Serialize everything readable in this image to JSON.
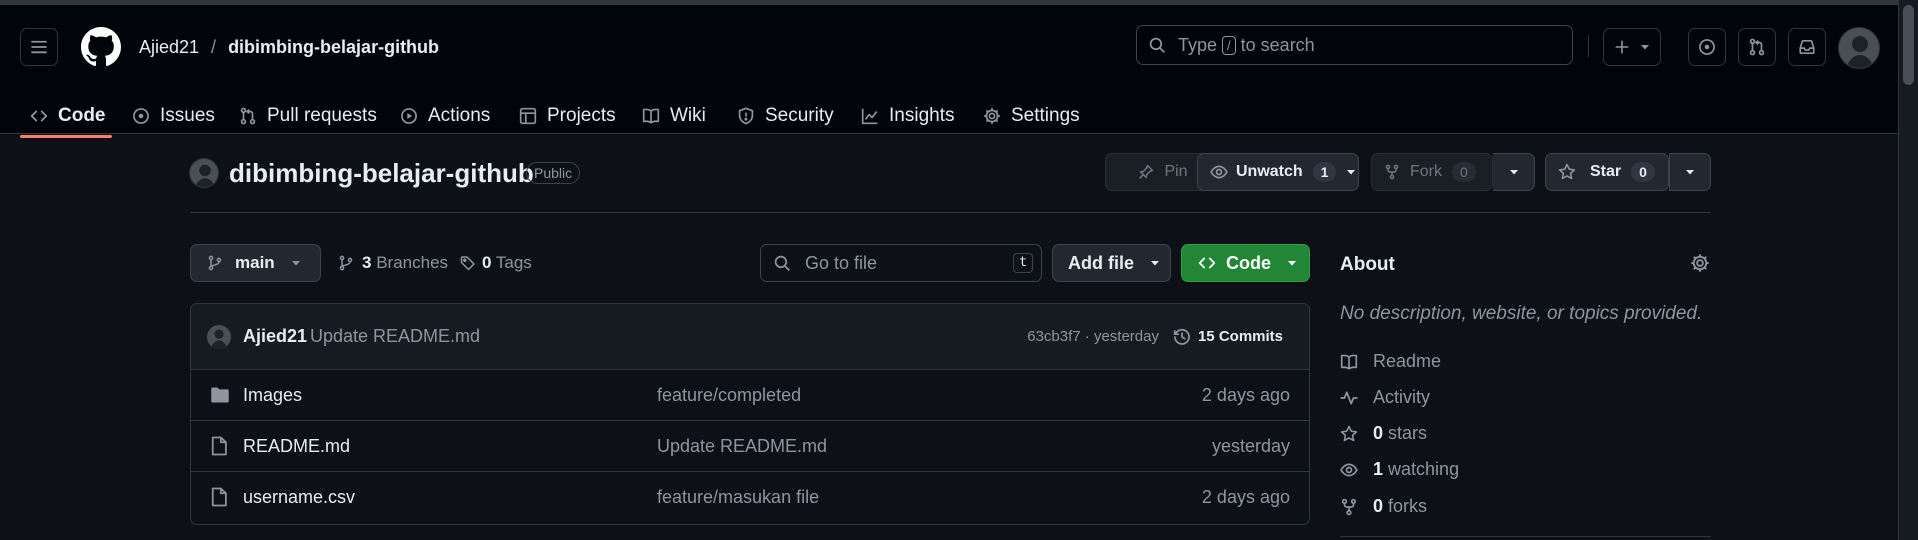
{
  "header": {
    "owner": "Ajied21",
    "separator": "/",
    "repo": "dibimbing-belajar-github",
    "search_prefix": "Type",
    "search_key": "/",
    "search_suffix": "to search"
  },
  "nav": {
    "tabs": [
      {
        "label": "Code",
        "icon": "code-icon"
      },
      {
        "label": "Issues",
        "icon": "issue-icon"
      },
      {
        "label": "Pull requests",
        "icon": "pull-request-icon"
      },
      {
        "label": "Actions",
        "icon": "play-icon"
      },
      {
        "label": "Projects",
        "icon": "table-icon"
      },
      {
        "label": "Wiki",
        "icon": "book-icon"
      },
      {
        "label": "Security",
        "icon": "shield-icon"
      },
      {
        "label": "Insights",
        "icon": "graph-icon"
      },
      {
        "label": "Settings",
        "icon": "gear-icon"
      }
    ]
  },
  "repo_header": {
    "name": "dibimbing-belajar-github",
    "visibility": "Public",
    "pin_label": "Pin",
    "unwatch_label": "Unwatch",
    "unwatch_count": "1",
    "fork_label": "Fork",
    "fork_count": "0",
    "star_label": "Star",
    "star_count": "0"
  },
  "toolbar": {
    "branch": "main",
    "branches_count": "3",
    "branches_label": "Branches",
    "tags_count": "0",
    "tags_label": "Tags",
    "goto_placeholder": "Go to file",
    "goto_key": "t",
    "add_file_label": "Add file",
    "code_label": "Code"
  },
  "commit": {
    "author": "Ajied21",
    "message": "Update README.md",
    "hash_time": "63cb3f7 · yesterday",
    "commits_label": "15 Commits"
  },
  "files": [
    {
      "name": "Images",
      "type": "folder",
      "message": "feature/completed",
      "date": "2 days ago"
    },
    {
      "name": "README.md",
      "type": "file",
      "message": "Update README.md",
      "date": "yesterday"
    },
    {
      "name": "username.csv",
      "type": "file",
      "message": "feature/masukan file",
      "date": "2 days ago"
    }
  ],
  "about": {
    "title": "About",
    "description": "No description, website, or topics provided.",
    "readme": "Readme",
    "activity": "Activity",
    "stars_count": "0",
    "stars_label": "stars",
    "watching_count": "1",
    "watching_label": "watching",
    "forks_count": "0",
    "forks_label": "forks"
  },
  "colors": {
    "background": "#0d1117",
    "header": "#010409",
    "accent_tab": "#f78166",
    "code_button": "#238636"
  }
}
